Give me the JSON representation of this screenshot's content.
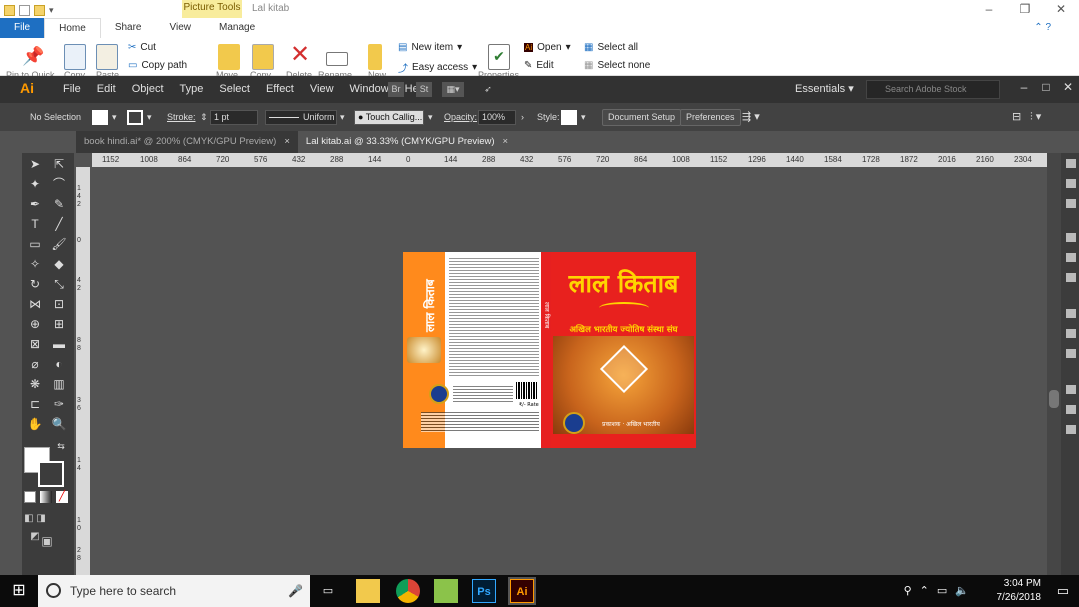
{
  "explorer": {
    "context_tab": "Picture Tools",
    "window_title": "Lal kitab",
    "tabs": [
      "File",
      "Home",
      "Share",
      "View",
      "Manage"
    ],
    "active_tab": "Home",
    "ribbon": {
      "cut": "Cut",
      "copy_path": "Copy path",
      "new_item": "New item",
      "easy_access": "Easy access",
      "open": "Open",
      "edit": "Edit",
      "select_all": "Select all",
      "select_none": "Select none",
      "pin_quick": "Pin to Quick",
      "copy": "Copy",
      "paste": "Paste",
      "move": "Move",
      "copy_to": "Copy",
      "delete": "Delete",
      "rename": "Rename",
      "new": "New",
      "properties": "Properties"
    }
  },
  "illustrator": {
    "logo": "Ai",
    "menu": [
      "File",
      "Edit",
      "Object",
      "Type",
      "Select",
      "Effect",
      "View",
      "Window",
      "Help"
    ],
    "essentials": "Essentials",
    "search_placeholder": "Search Adobe Stock",
    "control_bar": {
      "selection": "No Selection",
      "stroke_label": "Stroke:",
      "stroke_value": "1 pt",
      "stroke_profile": "Uniform",
      "brush": "Touch Callig...",
      "opacity_label": "Opacity:",
      "opacity_value": "100%",
      "style_label": "Style:",
      "document_setup": "Document Setup",
      "preferences": "Preferences"
    },
    "doc_tabs": [
      {
        "label": "book hindi.ai* @ 200% (CMYK/GPU Preview)",
        "active": false
      },
      {
        "label": "Lal kitab.ai @ 33.33% (CMYK/GPU Preview)",
        "active": true
      }
    ],
    "ruler_h": [
      "1152",
      "1008",
      "864",
      "720",
      "576",
      "432",
      "288",
      "144",
      "0",
      "144",
      "288",
      "432",
      "576",
      "720",
      "864",
      "1008",
      "1152",
      "1296",
      "1440",
      "1584",
      "1728",
      "1872",
      "2016",
      "2160",
      "2304"
    ],
    "ruler_v": [
      "1",
      "4",
      "2",
      "0",
      "4",
      "2",
      "8",
      "8",
      "3",
      "6",
      "1",
      "4",
      "1",
      "0",
      "2",
      "8"
    ]
  },
  "artboard": {
    "front_title": "लाल किताब",
    "front_subtitle": "अखिल भारतीय ज्योतिष संस्था संघ",
    "front_author": "प्रकाशक · अखिल भारतीय",
    "back_title": "लाल किताब",
    "spine_text": "लाल किताब",
    "price": "₹/- Rate"
  },
  "taskbar": {
    "search_placeholder": "Type here to search",
    "time": "3:04 PM",
    "date": "7/26/2018",
    "apps": [
      "Ps",
      "Ai"
    ]
  }
}
